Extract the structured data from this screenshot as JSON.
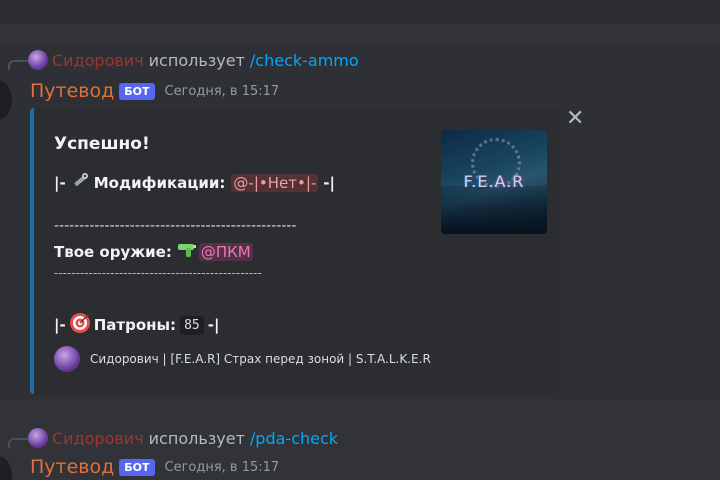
{
  "messages": [
    {
      "reply_user": "Сидорович",
      "reply_action": "использует",
      "reply_command": "/check-ammo",
      "author": "Путевод",
      "bot_tag": "БОТ",
      "timestamp": "Сегодня, в 15:17"
    },
    {
      "reply_user": "Сидорович",
      "reply_action": "использует",
      "reply_command": "/pda-check",
      "author": "Путевод",
      "bot_tag": "БОТ",
      "timestamp": "Сегодня, в 15:17"
    }
  ],
  "embed": {
    "title": "Успешно!",
    "mods_prefix": "|-",
    "mods_icon": "wrench-screwdriver-icon",
    "mods_label": "Модификации:",
    "mods_value": "@-|•Нет•|-",
    "mods_suffix": "-|",
    "divider1": "------------------------------------------------",
    "weapon_label": "Твое оружие:",
    "weapon_icon": "water-pistol-icon",
    "weapon_value": "@ПКМ",
    "divider2": "------------------------------------------------",
    "ammo_prefix": "|-",
    "ammo_icon": "target-icon",
    "ammo_label": "Патроны:",
    "ammo_value": "85",
    "ammo_suffix": "-|",
    "thumbnail_text": "F.E.A.R",
    "footer_text": "Сидорович | [F.E.A.R] Страх перед зоной | S.T.A.L.K.E.R",
    "accent_color": "#1f6fa5"
  },
  "close_label": "✕"
}
